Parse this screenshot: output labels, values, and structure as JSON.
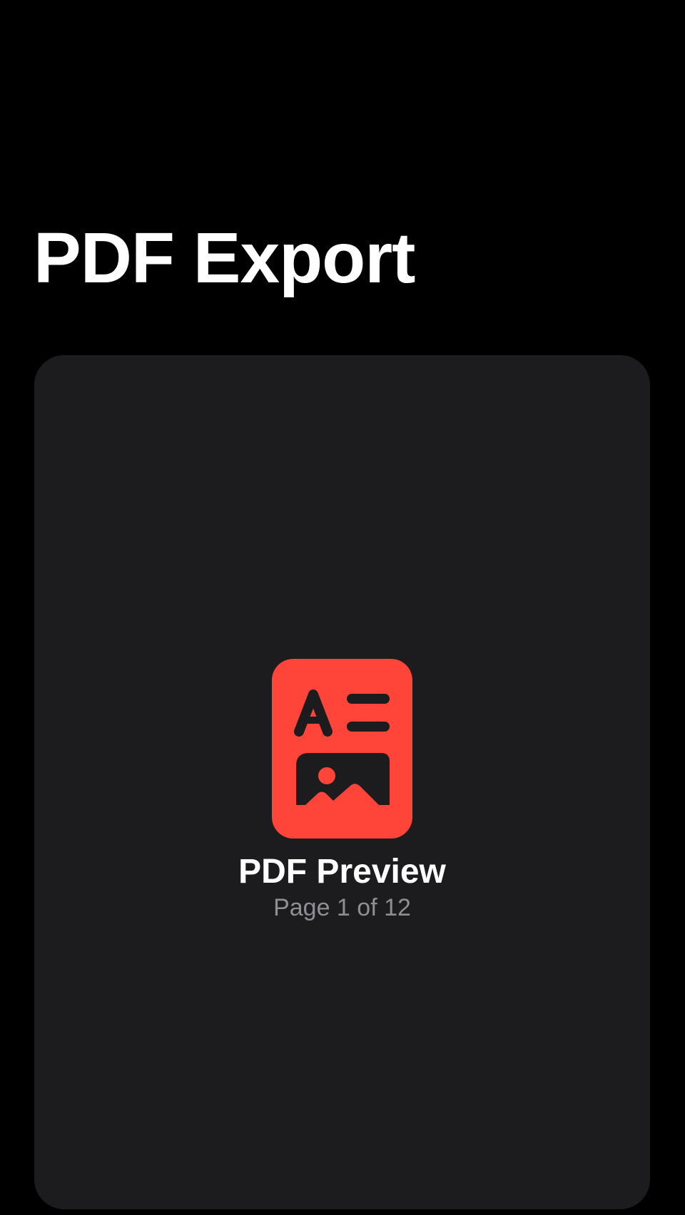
{
  "header": {
    "title": "PDF Export"
  },
  "preview": {
    "icon": "doc-richtext-icon",
    "title": "PDF Preview",
    "page_indicator": "Page 1 of 12"
  },
  "colors": {
    "background": "#000000",
    "card": "#1c1c1e",
    "accent": "#ff453a",
    "secondary_text": "#8e8e93"
  }
}
